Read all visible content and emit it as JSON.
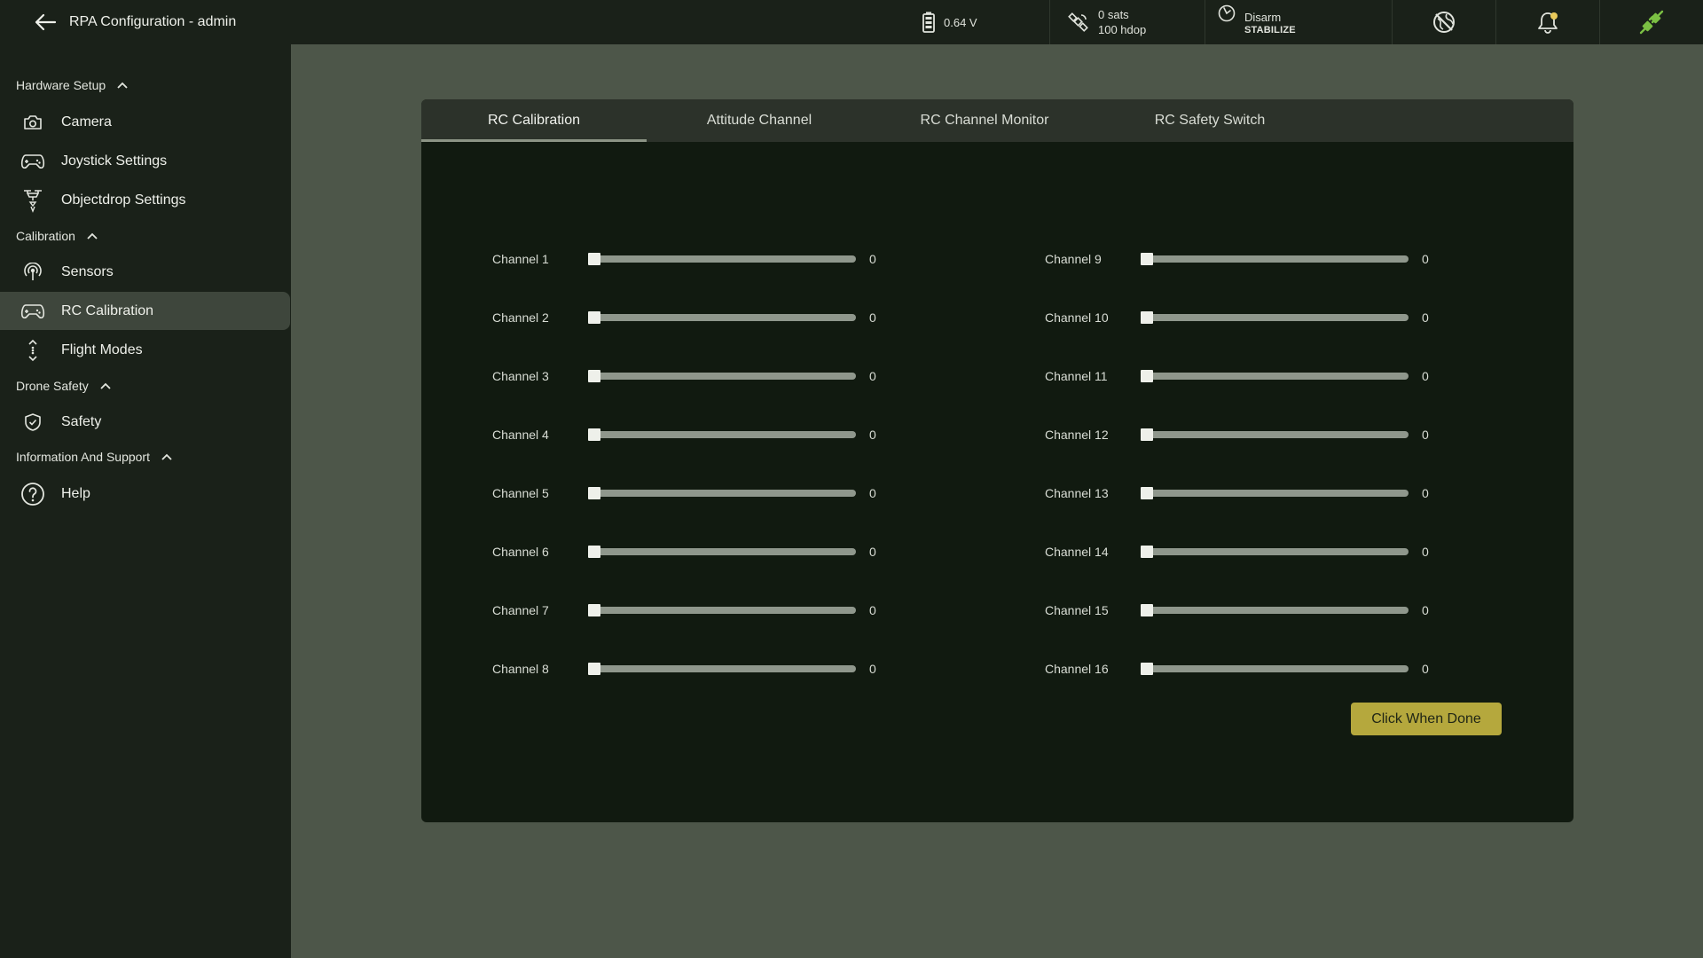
{
  "header": {
    "title": "RPA Configuration - admin",
    "battery": "0.64 V",
    "gps_sats": "0 sats",
    "gps_hdop": "100 hdop",
    "arm_state": "Disarm",
    "flight_mode": "STABILIZE",
    "icons": [
      "back-arrow-icon",
      "battery-icon",
      "satellite-icon",
      "arm-status-icon",
      "no-gps-lock-icon",
      "bell-icon",
      "connection-plug-icon"
    ],
    "colors": {
      "connection": "#7bc043",
      "notification_dot": "#e8c95a"
    }
  },
  "sidebar": {
    "sections": [
      {
        "label": "Hardware Setup",
        "items": [
          {
            "label": "Camera",
            "icon": "camera-icon"
          },
          {
            "label": "Joystick Settings",
            "icon": "gamepad-icon"
          },
          {
            "label": "Objectdrop Settings",
            "icon": "drone-drop-icon"
          }
        ]
      },
      {
        "label": "Calibration",
        "items": [
          {
            "label": "Sensors",
            "icon": "sensor-icon"
          },
          {
            "label": "RC Calibration",
            "icon": "gamepad-icon",
            "active": true
          },
          {
            "label": "Flight Modes",
            "icon": "flight-modes-icon"
          }
        ]
      },
      {
        "label": "Drone Safety",
        "items": [
          {
            "label": "Safety",
            "icon": "shield-icon"
          }
        ]
      },
      {
        "label": "Information And Support",
        "items": [
          {
            "label": "Help",
            "icon": "help-icon"
          }
        ]
      }
    ]
  },
  "main": {
    "tabs": [
      {
        "label": "RC Calibration",
        "active": true
      },
      {
        "label": "Attitude Channel"
      },
      {
        "label": "RC Channel Monitor"
      },
      {
        "label": "RC Safety Switch"
      }
    ],
    "channels": [
      {
        "label": "Channel 1",
        "value": "0"
      },
      {
        "label": "Channel 2",
        "value": "0"
      },
      {
        "label": "Channel 3",
        "value": "0"
      },
      {
        "label": "Channel 4",
        "value": "0"
      },
      {
        "label": "Channel 5",
        "value": "0"
      },
      {
        "label": "Channel 6",
        "value": "0"
      },
      {
        "label": "Channel 7",
        "value": "0"
      },
      {
        "label": "Channel 8",
        "value": "0"
      },
      {
        "label": "Channel 9",
        "value": "0"
      },
      {
        "label": "Channel 10",
        "value": "0"
      },
      {
        "label": "Channel 11",
        "value": "0"
      },
      {
        "label": "Channel 12",
        "value": "0"
      },
      {
        "label": "Channel 13",
        "value": "0"
      },
      {
        "label": "Channel 14",
        "value": "0"
      },
      {
        "label": "Channel 15",
        "value": "0"
      },
      {
        "label": "Channel 16",
        "value": "0"
      }
    ],
    "done_button": "Click When Done",
    "colors": {
      "button": "#b5a83d"
    }
  }
}
